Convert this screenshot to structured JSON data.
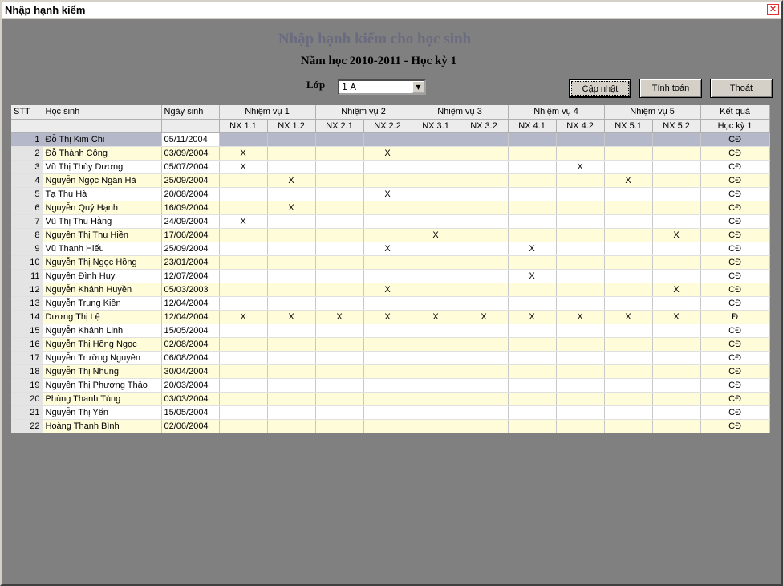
{
  "window": {
    "title": "Nhập hạnh kiểm",
    "close_glyph": "✕"
  },
  "header": {
    "title": "Nhập hạnh kiểm cho học sinh",
    "subtitle": "Năm học 2010-2011 - Học kỳ 1",
    "class_label": "Lớp",
    "class_value": "1 A"
  },
  "buttons": {
    "update": "Cập nhật",
    "calculate": "Tính toán",
    "exit": "Thoát"
  },
  "table": {
    "headers": {
      "stt": "STT",
      "student": "Học sinh",
      "dob": "Ngày sinh",
      "groups": [
        "Nhiệm vụ 1",
        "Nhiệm vụ 2",
        "Nhiệm vụ 3",
        "Nhiệm vụ 4",
        "Nhiệm vụ 5"
      ],
      "result": "Kết quả",
      "sub": [
        "NX 1.1",
        "NX 1.2",
        "NX 2.1",
        "NX 2.2",
        "NX 3.1",
        "NX 3.2",
        "NX 4.1",
        "NX 4.2",
        "NX 5.1",
        "NX 5.2"
      ],
      "result_sub": "Học kỳ 1"
    },
    "rows": [
      {
        "stt": "1",
        "name": "Đỗ Thị Kim Chi",
        "dob": "05/11/2004",
        "marks": [
          "",
          "",
          "",
          "",
          "",
          "",
          "",
          "",
          "",
          ""
        ],
        "result": "CĐ"
      },
      {
        "stt": "2",
        "name": "Đỗ Thành Công",
        "dob": "03/09/2004",
        "marks": [
          "X",
          "",
          "",
          "X",
          "",
          "",
          "",
          "",
          "",
          ""
        ],
        "result": "CĐ"
      },
      {
        "stt": "3",
        "name": "Vũ Thị Thùy Dương",
        "dob": "05/07/2004",
        "marks": [
          "X",
          "",
          "",
          "",
          "",
          "",
          "",
          "X",
          "",
          ""
        ],
        "result": "CĐ"
      },
      {
        "stt": "4",
        "name": "Nguyễn Ngọc Ngân Hà",
        "dob": "25/09/2004",
        "marks": [
          "",
          "X",
          "",
          "",
          "",
          "",
          "",
          "",
          "X",
          ""
        ],
        "result": "CĐ"
      },
      {
        "stt": "5",
        "name": "Tạ Thu Hà",
        "dob": "20/08/2004",
        "marks": [
          "",
          "",
          "",
          "X",
          "",
          "",
          "",
          "",
          "",
          ""
        ],
        "result": "CĐ"
      },
      {
        "stt": "6",
        "name": "Nguyễn Quý Hạnh",
        "dob": "16/09/2004",
        "marks": [
          "",
          "X",
          "",
          "",
          "",
          "",
          "",
          "",
          "",
          ""
        ],
        "result": "CĐ"
      },
      {
        "stt": "7",
        "name": "Vũ Thị Thu Hằng",
        "dob": "24/09/2004",
        "marks": [
          "X",
          "",
          "",
          "",
          "",
          "",
          "",
          "",
          "",
          ""
        ],
        "result": "CĐ"
      },
      {
        "stt": "8",
        "name": "Nguyễn Thị Thu Hiền",
        "dob": "17/06/2004",
        "marks": [
          "",
          "",
          "",
          "",
          "X",
          "",
          "",
          "",
          "",
          "X"
        ],
        "result": "CĐ"
      },
      {
        "stt": "9",
        "name": "Vũ Thanh Hiếu",
        "dob": "25/09/2004",
        "marks": [
          "",
          "",
          "",
          "X",
          "",
          "",
          "X",
          "",
          "",
          ""
        ],
        "result": "CĐ"
      },
      {
        "stt": "10",
        "name": "Nguyễn Thị Ngọc Hồng",
        "dob": "23/01/2004",
        "marks": [
          "",
          "",
          "",
          "",
          "",
          "",
          "",
          "",
          "",
          ""
        ],
        "result": "CĐ"
      },
      {
        "stt": "11",
        "name": "Nguyễn Đình Huy",
        "dob": "12/07/2004",
        "marks": [
          "",
          "",
          "",
          "",
          "",
          "",
          "X",
          "",
          "",
          ""
        ],
        "result": "CĐ"
      },
      {
        "stt": "12",
        "name": "Nguyễn Khánh Huyền",
        "dob": "05/03/2003",
        "marks": [
          "",
          "",
          "",
          "X",
          "",
          "",
          "",
          "",
          "",
          "X"
        ],
        "result": "CĐ"
      },
      {
        "stt": "13",
        "name": "Nguyễn Trung Kiên",
        "dob": "12/04/2004",
        "marks": [
          "",
          "",
          "",
          "",
          "",
          "",
          "",
          "",
          "",
          ""
        ],
        "result": "CĐ"
      },
      {
        "stt": "14",
        "name": "Dương Thị Lệ",
        "dob": "12/04/2004",
        "marks": [
          "X",
          "X",
          "X",
          "X",
          "X",
          "X",
          "X",
          "X",
          "X",
          "X"
        ],
        "result": "Đ"
      },
      {
        "stt": "15",
        "name": "Nguyễn Khánh Linh",
        "dob": "15/05/2004",
        "marks": [
          "",
          "",
          "",
          "",
          "",
          "",
          "",
          "",
          "",
          ""
        ],
        "result": "CĐ"
      },
      {
        "stt": "16",
        "name": "Nguyễn Thị Hồng Ngọc",
        "dob": "02/08/2004",
        "marks": [
          "",
          "",
          "",
          "",
          "",
          "",
          "",
          "",
          "",
          ""
        ],
        "result": "CĐ"
      },
      {
        "stt": "17",
        "name": "Nguyễn Trường Nguyên",
        "dob": "06/08/2004",
        "marks": [
          "",
          "",
          "",
          "",
          "",
          "",
          "",
          "",
          "",
          ""
        ],
        "result": "CĐ"
      },
      {
        "stt": "18",
        "name": "Nguyễn Thị Nhung",
        "dob": "30/04/2004",
        "marks": [
          "",
          "",
          "",
          "",
          "",
          "",
          "",
          "",
          "",
          ""
        ],
        "result": "CĐ"
      },
      {
        "stt": "19",
        "name": "Nguyễn Thị Phương Thảo",
        "dob": "20/03/2004",
        "marks": [
          "",
          "",
          "",
          "",
          "",
          "",
          "",
          "",
          "",
          ""
        ],
        "result": "CĐ"
      },
      {
        "stt": "20",
        "name": "Phùng Thanh Tùng",
        "dob": "03/03/2004",
        "marks": [
          "",
          "",
          "",
          "",
          "",
          "",
          "",
          "",
          "",
          ""
        ],
        "result": "CĐ"
      },
      {
        "stt": "21",
        "name": "Nguyễn Thị Yến",
        "dob": "15/05/2004",
        "marks": [
          "",
          "",
          "",
          "",
          "",
          "",
          "",
          "",
          "",
          ""
        ],
        "result": "CĐ"
      },
      {
        "stt": "22",
        "name": "Hoàng Thanh Bình",
        "dob": "02/06/2004",
        "marks": [
          "",
          "",
          "",
          "",
          "",
          "",
          "",
          "",
          "",
          ""
        ],
        "result": "CĐ"
      }
    ]
  }
}
